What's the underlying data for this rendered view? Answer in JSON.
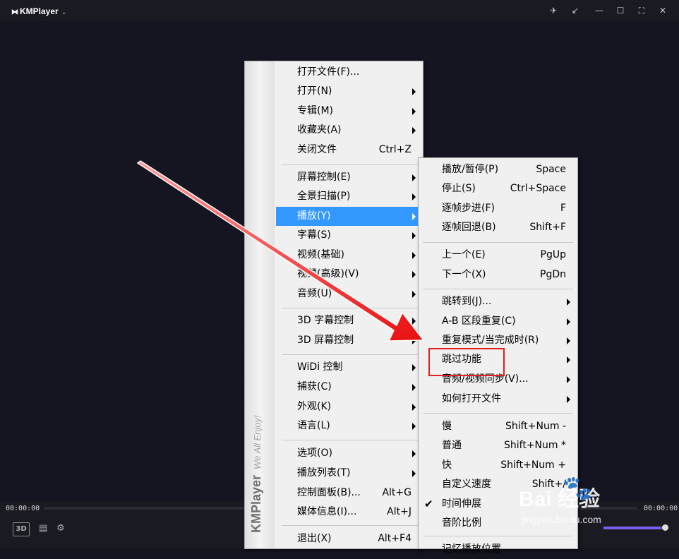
{
  "app": {
    "title": "KMPlayer",
    "caret": "⌄"
  },
  "window_controls": [
    {
      "name": "pin-icon",
      "glyph": "✈"
    },
    {
      "name": "minimize-to-corner-icon",
      "glyph": "↙"
    },
    {
      "name": "minimize-icon",
      "glyph": "—"
    },
    {
      "name": "maximize-icon",
      "glyph": "☐"
    },
    {
      "name": "fullscreen-icon",
      "glyph": "⛶"
    },
    {
      "name": "close-icon",
      "glyph": "✕"
    }
  ],
  "player": {
    "time_elapsed": "00:00:00",
    "time_total": "00:00:00",
    "btn_3d": "3D",
    "volume": 0.9
  },
  "sidebar": {
    "brand": "KMPlayer",
    "slogan": "We All Enjoy!"
  },
  "main_menu": [
    {
      "label": "打开文件(F)..."
    },
    {
      "label": "打开(N)",
      "submenu": true
    },
    {
      "label": "专辑(M)",
      "submenu": true
    },
    {
      "label": "收藏夹(A)",
      "submenu": true
    },
    {
      "label": "关闭文件",
      "shortcut": "Ctrl+Z"
    },
    {
      "label": "屏幕控制(E)",
      "submenu": true
    },
    {
      "label": "全景扫描(P)",
      "submenu": true
    },
    {
      "label": "播放(Y)",
      "submenu": true,
      "active": true
    },
    {
      "label": "字幕(S)",
      "submenu": true
    },
    {
      "label": "视频(基础)",
      "submenu": true
    },
    {
      "label": "视频(高级)(V)",
      "submenu": true
    },
    {
      "label": "音频(U)",
      "submenu": true
    },
    {
      "label": "3D 字幕控制",
      "submenu": true
    },
    {
      "label": "3D 屏幕控制",
      "submenu": true
    },
    {
      "label": "WiDi 控制",
      "submenu": true
    },
    {
      "label": "捕获(C)",
      "submenu": true
    },
    {
      "label": "外观(K)",
      "submenu": true
    },
    {
      "label": "语言(L)",
      "submenu": true
    },
    {
      "label": "选项(O)",
      "submenu": true
    },
    {
      "label": "播放列表(T)",
      "submenu": true
    },
    {
      "label": "控制面板(B)...",
      "shortcut": "Alt+G"
    },
    {
      "label": "媒体信息(I)...",
      "shortcut": "Alt+J"
    },
    {
      "label": "退出(X)",
      "shortcut": "Alt+F4"
    }
  ],
  "play_menu": [
    {
      "label": "播放/暂停(P)",
      "shortcut": "Space"
    },
    {
      "label": "停止(S)",
      "shortcut": "Ctrl+Space"
    },
    {
      "label": "逐帧步进(F)",
      "shortcut": "F"
    },
    {
      "label": "逐帧回退(B)",
      "shortcut": "Shift+F"
    },
    {
      "label": "上一个(E)",
      "shortcut": "PgUp"
    },
    {
      "label": "下一个(X)",
      "shortcut": "PgDn"
    },
    {
      "label": "跳转到(J)...",
      "submenu": true
    },
    {
      "label": "A-B 区段重复(C)",
      "submenu": true
    },
    {
      "label": "重复模式/当完成时(R)",
      "submenu": true
    },
    {
      "label": "跳过功能",
      "submenu": true
    },
    {
      "label": "音频/视频同步(V)...",
      "submenu": true
    },
    {
      "label": "如何打开文件",
      "submenu": true
    },
    {
      "label": "慢",
      "shortcut": "Shift+Num -"
    },
    {
      "label": "普通",
      "shortcut": "Shift+Num *"
    },
    {
      "label": "快",
      "shortcut": "Shift+Num +"
    },
    {
      "label": "自定义速度",
      "shortcut": "Shift+/"
    },
    {
      "label": "时间伸展",
      "checked": true
    },
    {
      "label": "音阶比例"
    },
    {
      "label": "记忆播放位置"
    }
  ],
  "watermark": {
    "brand": "Bai  经验",
    "url": "jingyan.baidu.com"
  }
}
